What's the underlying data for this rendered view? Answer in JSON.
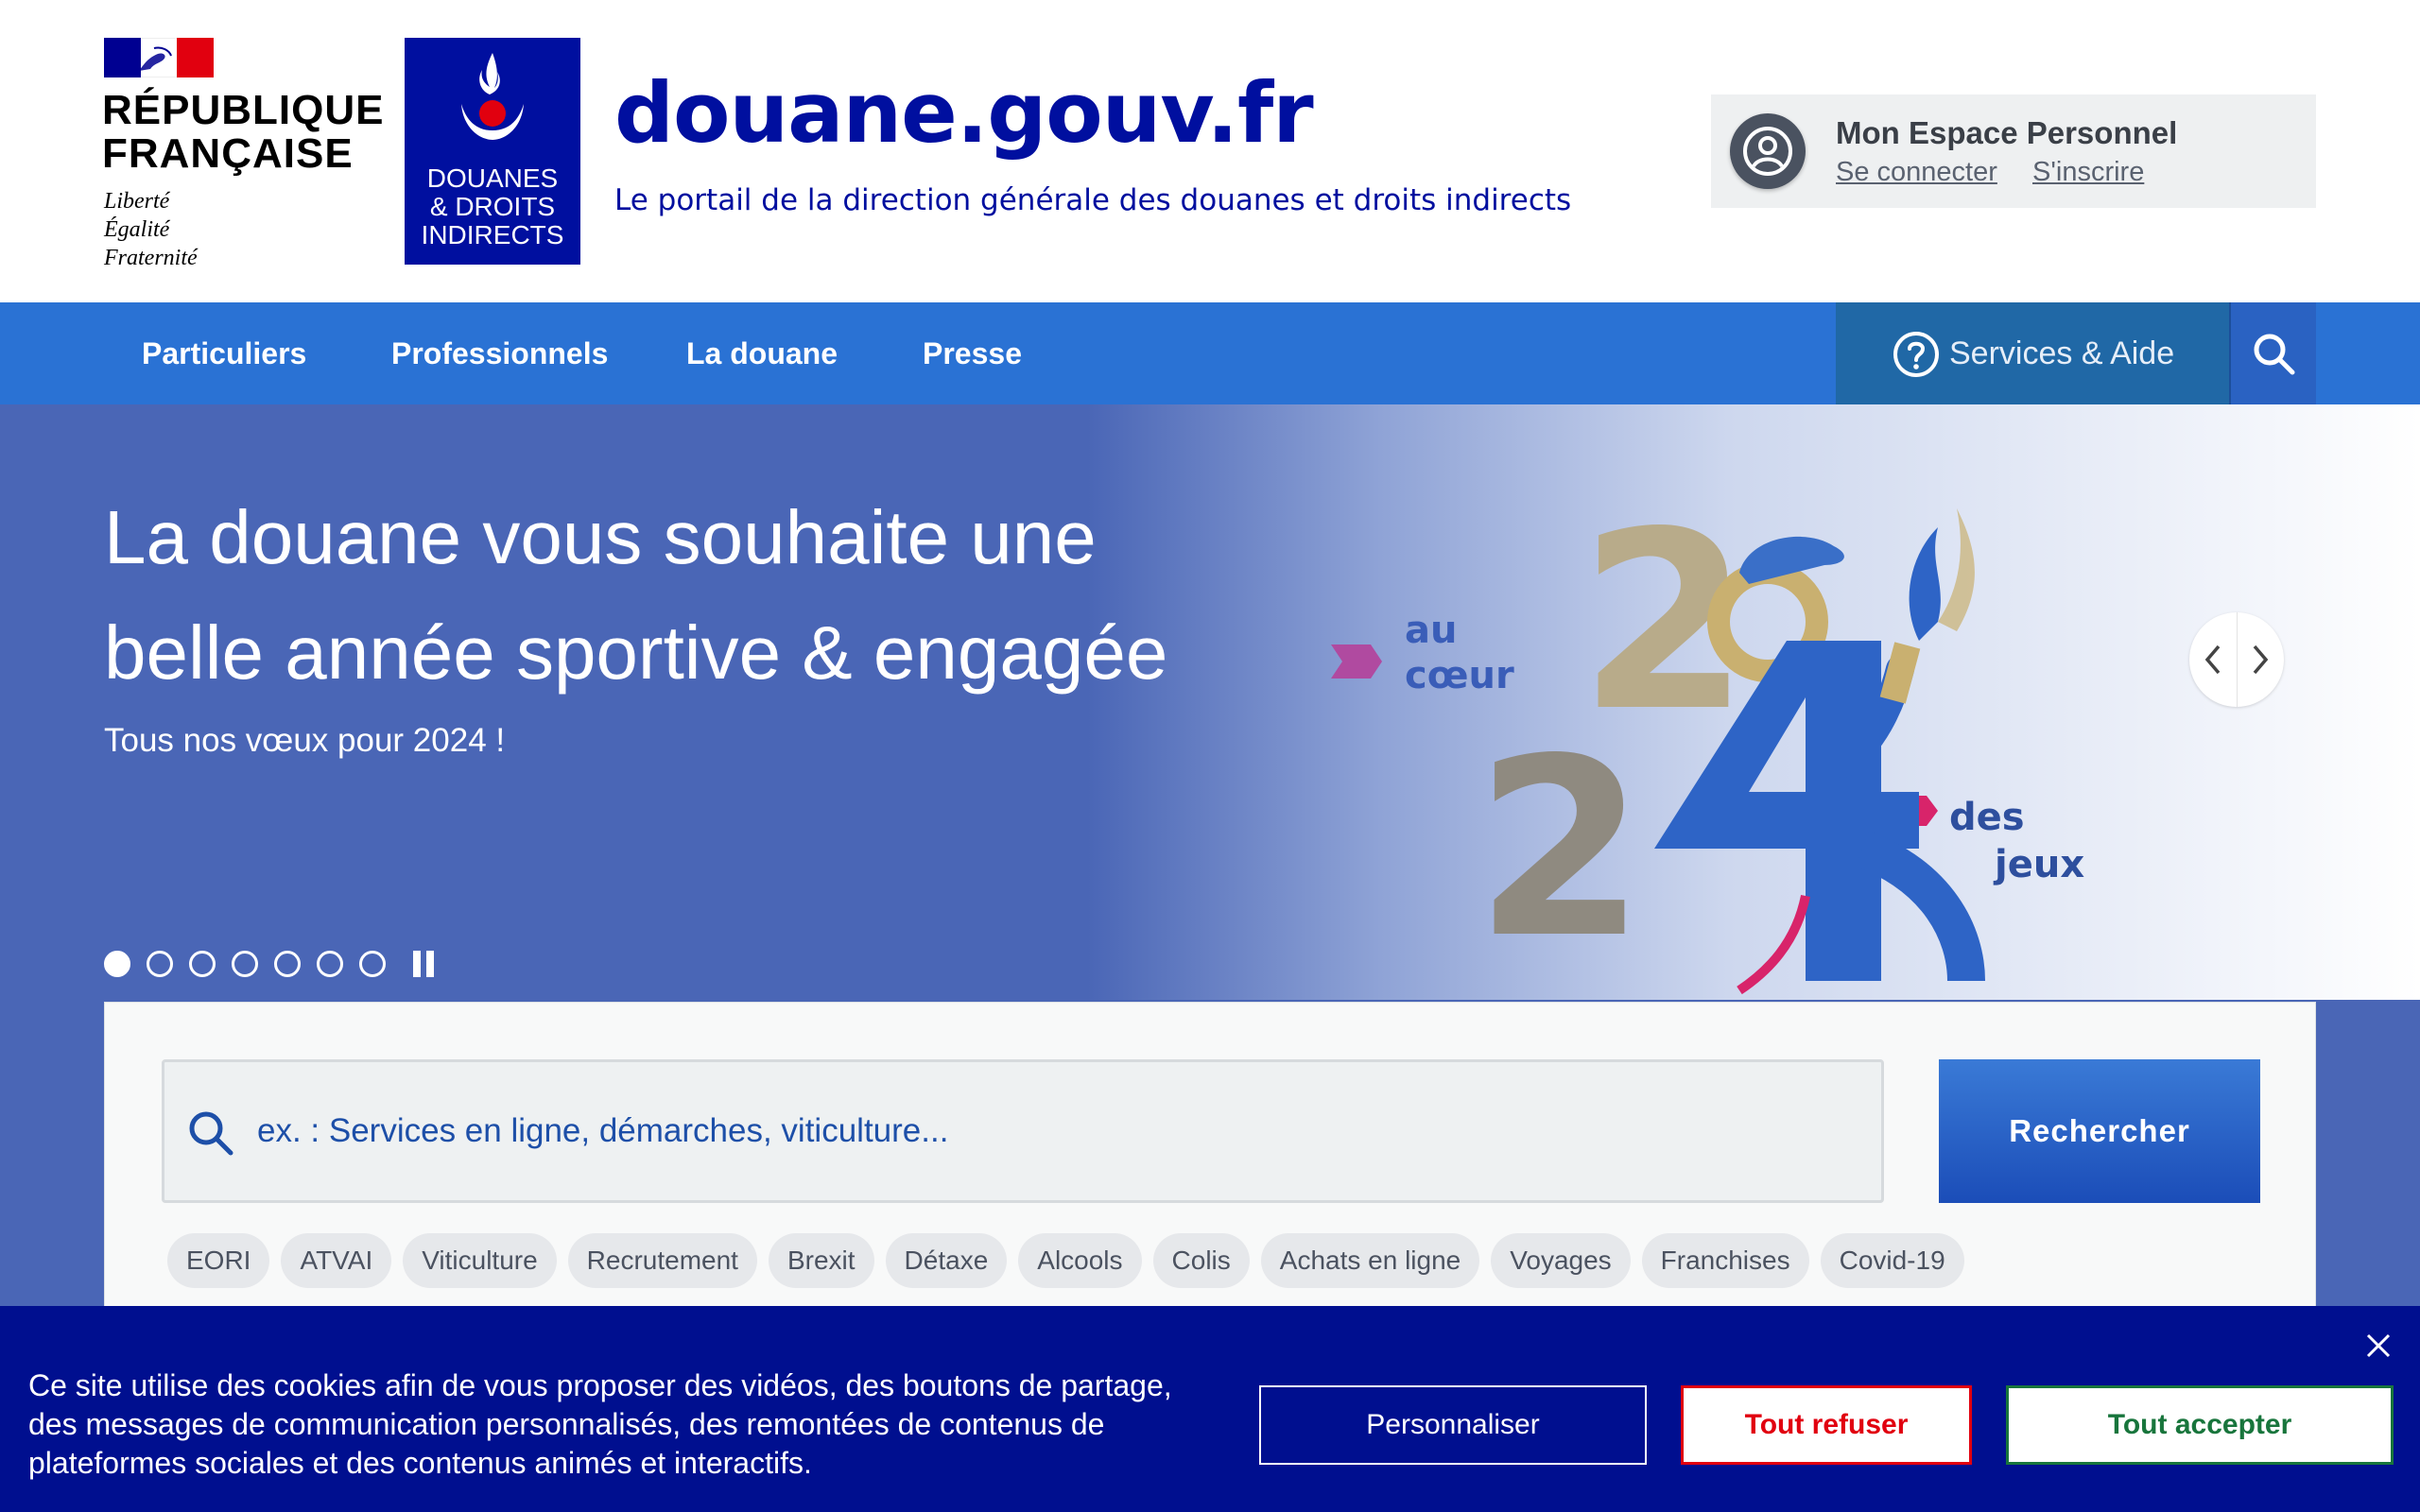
{
  "header": {
    "republique_line1": "RÉPUBLIQUE",
    "republique_line2": "FRANÇAISE",
    "motto_1": "Liberté",
    "motto_2": "Égalité",
    "motto_3": "Fraternité",
    "ddi_line1": "DOUANES",
    "ddi_line2": "& DROITS",
    "ddi_line3": "INDIRECTS",
    "site_title": "douane.gouv.fr",
    "site_subtitle": "Le portail de la direction générale des douanes et droits indirects"
  },
  "espace": {
    "title": "Mon Espace Personnel",
    "login": "Se connecter",
    "register": "S'inscrire",
    "icon": "user-circle-icon"
  },
  "nav": {
    "items": [
      "Particuliers",
      "Professionnels",
      "La douane",
      "Presse"
    ],
    "services": "Services & Aide",
    "services_icon": "question-circle-icon",
    "search_icon": "search-icon"
  },
  "hero": {
    "title_line1": "La douane vous souhaite une",
    "title_line2": "belle année sportive & engagée",
    "subtitle": "Tous nos vœux pour 2024 !",
    "art_text_au": "au",
    "art_text_coeur": "cœur",
    "art_text_des": "des",
    "art_text_jeux": "jeux",
    "art_digits": [
      "2",
      "0",
      "2",
      "4"
    ],
    "slides_total": 7,
    "active_slide": 1
  },
  "search": {
    "placeholder": "ex. : Services en ligne, démarches, viticulture...",
    "button": "Rechercher",
    "tags": [
      "EORI",
      "ATVAI",
      "Viticulture",
      "Recrutement",
      "Brexit",
      "Détaxe",
      "Alcools",
      "Colis",
      "Achats en ligne",
      "Voyages",
      "Franchises",
      "Covid-19"
    ]
  },
  "cookie": {
    "text": "Ce site utilise des cookies afin de vous proposer des vidéos, des boutons de partage, des messages de communication personnalisés, des remontées de contenus de plateformes sociales et des contenus animés et interactifs.",
    "personalize": "Personnaliser",
    "refuse": "Tout refuser",
    "accept": "Tout accepter"
  },
  "colors": {
    "brand_blue": "#000f9f",
    "nav_blue": "#2a72d4",
    "hero_blue": "#4a66b6",
    "cookie_bg": "#000f8f",
    "refuse_red": "#e1000f",
    "accept_green": "#18753c"
  }
}
